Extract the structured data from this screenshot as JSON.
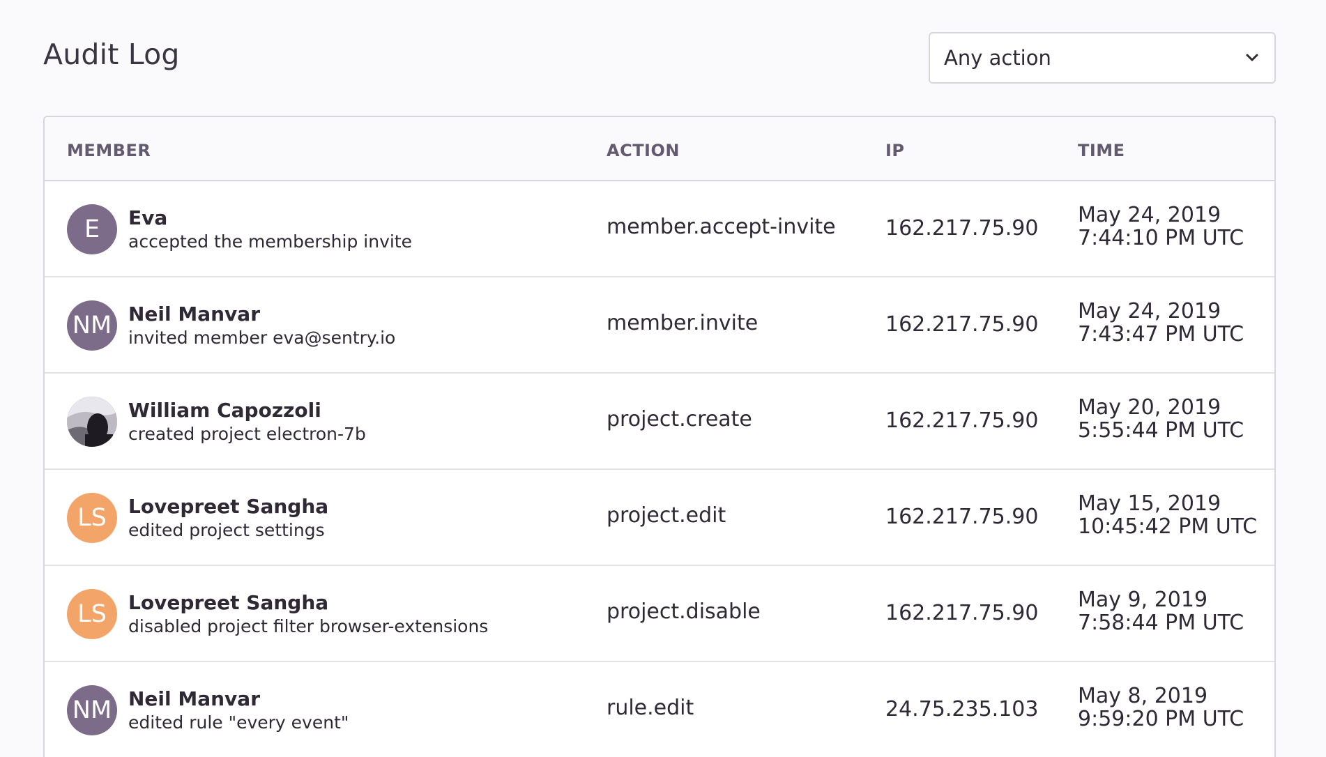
{
  "page": {
    "title": "Audit Log"
  },
  "filter": {
    "selected": "Any action",
    "icon": "chevron-down-icon"
  },
  "table": {
    "columns": [
      "MEMBER",
      "ACTION",
      "IP",
      "TIME"
    ],
    "rows": [
      {
        "avatar_initials": "E",
        "avatar_color": "#7C6B89",
        "name": "Eva",
        "note": "accepted the membership invite",
        "action": "member.accept-invite",
        "ip": "162.217.75.90",
        "date": "May 24, 2019",
        "time": "7:44:10 PM UTC"
      },
      {
        "avatar_initials": "NM",
        "avatar_color": "#7C6B89",
        "name": "Neil Manvar",
        "note": "invited member eva@sentry.io",
        "action": "member.invite",
        "ip": "162.217.75.90",
        "date": "May 24, 2019",
        "time": "7:43:47 PM UTC"
      },
      {
        "avatar_initials": "",
        "avatar_color": "#3C3C42",
        "avatar_photo": true,
        "name": "William Capozzoli",
        "note": "created project electron-7b",
        "action": "project.create",
        "ip": "162.217.75.90",
        "date": "May 20, 2019",
        "time": "5:55:44 PM UTC"
      },
      {
        "avatar_initials": "LS",
        "avatar_color": "#F3A469",
        "name": "Lovepreet Sangha",
        "note": "edited project settings",
        "action": "project.edit",
        "ip": "162.217.75.90",
        "date": "May 15, 2019",
        "time": "10:45:42 PM UTC"
      },
      {
        "avatar_initials": "LS",
        "avatar_color": "#F3A469",
        "name": "Lovepreet Sangha",
        "note": "disabled project filter browser-extensions",
        "action": "project.disable",
        "ip": "162.217.75.90",
        "date": "May 9, 2019",
        "time": "7:58:44 PM UTC"
      },
      {
        "avatar_initials": "NM",
        "avatar_color": "#7C6B89",
        "name": "Neil Manvar",
        "note": "edited rule \"every event\"",
        "action": "rule.edit",
        "ip": "24.75.235.103",
        "date": "May 8, 2019",
        "time": "9:59:20 PM UTC"
      }
    ]
  }
}
